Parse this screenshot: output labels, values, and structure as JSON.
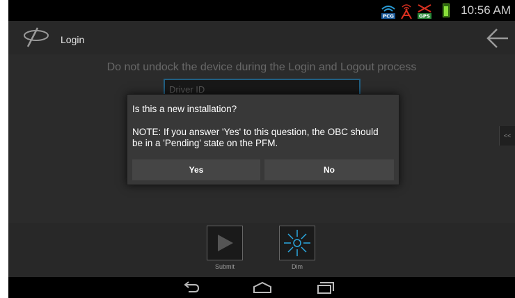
{
  "status": {
    "time": "10:56 AM",
    "icons": [
      "pcg-wifi-icon",
      "gps-signal-icon",
      "gps-off-icon",
      "battery-icon"
    ]
  },
  "action_bar": {
    "title": "Login"
  },
  "content": {
    "warning": "Do not undock the device during the Login and Logout process",
    "driver_id_placeholder": "Driver ID",
    "side_button": "<<"
  },
  "dialog": {
    "title": "Is this a new installation?",
    "message": "NOTE: If you answer 'Yes' to this question, the OBC should be in a 'Pending' state on the PFM.",
    "yes": "Yes",
    "no": "No"
  },
  "bottom_buttons": {
    "submit": "Submit",
    "dim": "Dim"
  },
  "colors": {
    "accent": "#2d7fae",
    "dim_icon": "#2aa8e0",
    "background": "#3a3a3a"
  }
}
